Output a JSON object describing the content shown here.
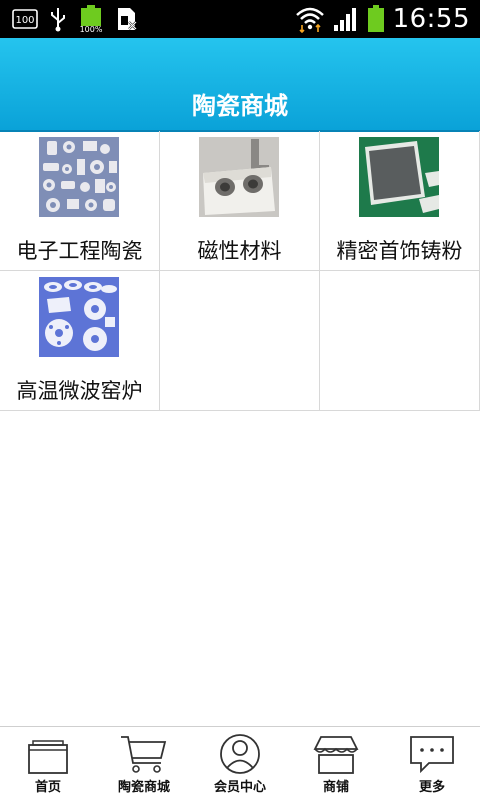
{
  "status_bar": {
    "clock": "16:55",
    "battery_small_label": "100%",
    "icons": [
      "screenshot-100-icon",
      "usb-icon",
      "battery-full-icon",
      "sim-card-blocked-icon",
      "wifi-icon",
      "signal-icon",
      "battery-icon"
    ]
  },
  "header": {
    "title": "陶瓷商城"
  },
  "grid": {
    "items": [
      {
        "label": "电子工程陶瓷",
        "image": "ceramic-parts-image"
      },
      {
        "label": "磁性材料",
        "image": "magnetic-block-image"
      },
      {
        "label": "精密首饰铸粉",
        "image": "green-plates-image"
      },
      {
        "label": "高温微波窑炉",
        "image": "white-rings-image"
      }
    ]
  },
  "bottom_nav": {
    "items": [
      {
        "label": "首页",
        "icon": "home-icon"
      },
      {
        "label": "陶瓷商城",
        "icon": "cart-icon"
      },
      {
        "label": "会员中心",
        "icon": "user-icon"
      },
      {
        "label": "商铺",
        "icon": "shop-icon"
      },
      {
        "label": "更多",
        "icon": "more-icon"
      }
    ]
  },
  "colors": {
    "header": "#0aa2d8",
    "status_bar": "#000000",
    "battery": "#6ecb1f"
  }
}
